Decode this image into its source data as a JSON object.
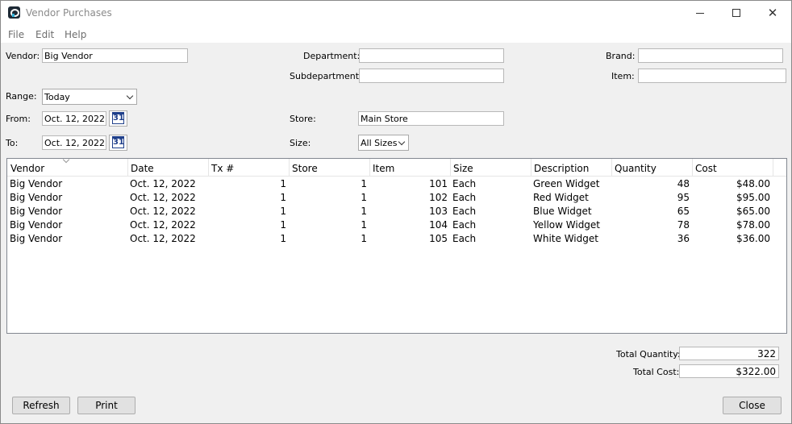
{
  "window": {
    "title": "Vendor Purchases",
    "icon": "app-logo-icon"
  },
  "menu": [
    "File",
    "Edit",
    "Help"
  ],
  "filters": {
    "vendor_label": "Vendor:",
    "vendor_value": "Big Vendor",
    "department_label": "Department:",
    "department_value": "",
    "subdepartment_label": "Subdepartment:",
    "subdepartment_value": "",
    "brand_label": "Brand:",
    "brand_value": "",
    "item_label": "Item:",
    "item_value": "",
    "range_label": "Range:",
    "range_value": "Today",
    "from_label": "From:",
    "from_value": "Oct. 12, 2022",
    "to_label": "To:",
    "to_value": "Oct. 12, 2022",
    "calendar_icon_text": "31",
    "store_label": "Store:",
    "store_value": "Main Store",
    "size_label": "Size:",
    "size_value": "All Sizes"
  },
  "table": {
    "columns": [
      "Vendor",
      "Date",
      "Tx #",
      "Store",
      "Item",
      "Size",
      "Description",
      "Quantity",
      "Cost"
    ],
    "rows": [
      [
        "Big Vendor",
        "Oct. 12, 2022",
        "1",
        "1",
        "101",
        "Each",
        "Green Widget",
        "48",
        "$48.00"
      ],
      [
        "Big Vendor",
        "Oct. 12, 2022",
        "1",
        "1",
        "102",
        "Each",
        "Red Widget",
        "95",
        "$95.00"
      ],
      [
        "Big Vendor",
        "Oct. 12, 2022",
        "1",
        "1",
        "103",
        "Each",
        "Blue Widget",
        "65",
        "$65.00"
      ],
      [
        "Big Vendor",
        "Oct. 12, 2022",
        "1",
        "1",
        "104",
        "Each",
        "Yellow Widget",
        "78",
        "$78.00"
      ],
      [
        "Big Vendor",
        "Oct. 12, 2022",
        "1",
        "1",
        "105",
        "Each",
        "White Widget",
        "36",
        "$36.00"
      ]
    ]
  },
  "totals": {
    "quantity_label": "Total Quantity:",
    "quantity_value": "322",
    "cost_label": "Total Cost:",
    "cost_value": "$322.00"
  },
  "buttons": {
    "refresh": "Refresh",
    "print": "Print",
    "close": "Close"
  }
}
